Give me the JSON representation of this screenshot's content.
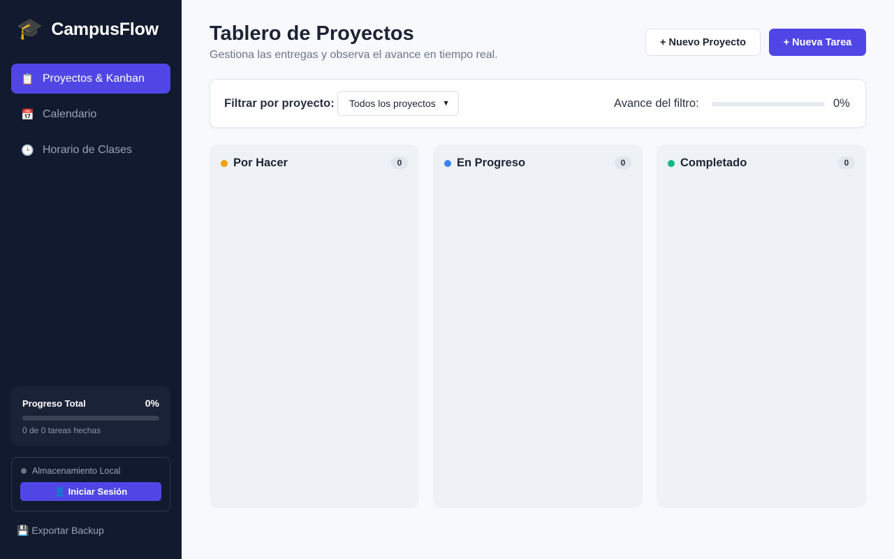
{
  "app": {
    "logo_icon": "graduation-cap",
    "name": "CampusFlow"
  },
  "sidebar": {
    "items": [
      {
        "icon": "clipboard",
        "glyph": "📋",
        "label": "Proyectos & Kanban",
        "active": true
      },
      {
        "icon": "calendar",
        "glyph": "📅",
        "label": "Calendario",
        "active": false
      },
      {
        "icon": "clock",
        "glyph": "🕒",
        "label": "Horario de Clases",
        "active": false
      }
    ],
    "progress": {
      "title": "Progreso Total",
      "percent_label": "0%",
      "value": 0,
      "subtitle": "0 de 0 tareas hechas"
    },
    "storage": {
      "label": "Almacenamiento Local",
      "login_label": "👤 Iniciar Sesión"
    },
    "export_label": "💾 Exportar Backup"
  },
  "header": {
    "title": "Tablero de Proyectos",
    "subtitle": "Gestiona las entregas y observa el avance en tiempo real.",
    "new_project_label": "+ Nuevo Proyecto",
    "new_task_label": "+ Nueva Tarea"
  },
  "filter": {
    "label": "Filtrar por proyecto:",
    "selected": "Todos los proyectos",
    "progress_label": "Avance del filtro:",
    "progress_value": 0,
    "progress_percent_label": "0%"
  },
  "columns": [
    {
      "title": "Por Hacer",
      "count": "0",
      "color": "#f59e0b"
    },
    {
      "title": "En Progreso",
      "count": "0",
      "color": "#3b82f6"
    },
    {
      "title": "Completado",
      "count": "0",
      "color": "#10b981"
    }
  ],
  "colors": {
    "accent": "#4f46e5",
    "sidebar_bg": "#111a2e"
  }
}
